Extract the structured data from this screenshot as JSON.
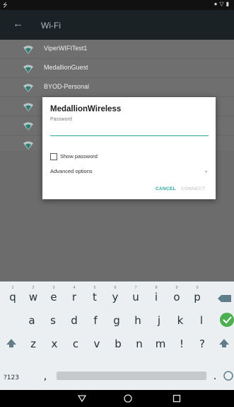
{
  "status_bar": {
    "left_icon": "usb-icon",
    "right_icons": [
      "location-icon",
      "signal-icon",
      "battery-icon"
    ]
  },
  "appbar": {
    "title": "Wi-Fi",
    "back_icon": "arrow-left-icon"
  },
  "wifi_networks": [
    {
      "ssid": "ViperWIFITest1"
    },
    {
      "ssid": "MedallionGuest"
    },
    {
      "ssid": "BYOD-Personal"
    },
    {
      "ssid": ""
    },
    {
      "ssid": ""
    },
    {
      "ssid": ""
    }
  ],
  "dialog": {
    "title": "MedallionWireless",
    "password_placeholder": "Password",
    "password_value": "",
    "show_password_label": "Show password",
    "show_password_checked": false,
    "advanced_options_label": "Advanced options",
    "cancel_label": "CANCEL",
    "connect_label": "CONNECT"
  },
  "keyboard": {
    "row1": [
      {
        "ch": "q",
        "hint": "1"
      },
      {
        "ch": "w",
        "hint": "2"
      },
      {
        "ch": "e",
        "hint": "3"
      },
      {
        "ch": "r",
        "hint": "4"
      },
      {
        "ch": "t",
        "hint": "5"
      },
      {
        "ch": "y",
        "hint": "6"
      },
      {
        "ch": "u",
        "hint": "7"
      },
      {
        "ch": "i",
        "hint": "8"
      },
      {
        "ch": "o",
        "hint": "9"
      },
      {
        "ch": "p",
        "hint": "0"
      }
    ],
    "row2": [
      "a",
      "s",
      "d",
      "f",
      "g",
      "h",
      "j",
      "k",
      "l"
    ],
    "row3": [
      "z",
      "x",
      "c",
      "v",
      "b",
      "n",
      "m",
      "!",
      "?"
    ],
    "row4": {
      "symbols_label": "?123",
      "comma": ",",
      "period": "."
    },
    "accent_color": "#4caf50"
  },
  "colors": {
    "accent": "#26a69a",
    "appbar": "#1a2225",
    "scrim": "#6f6f6f"
  }
}
